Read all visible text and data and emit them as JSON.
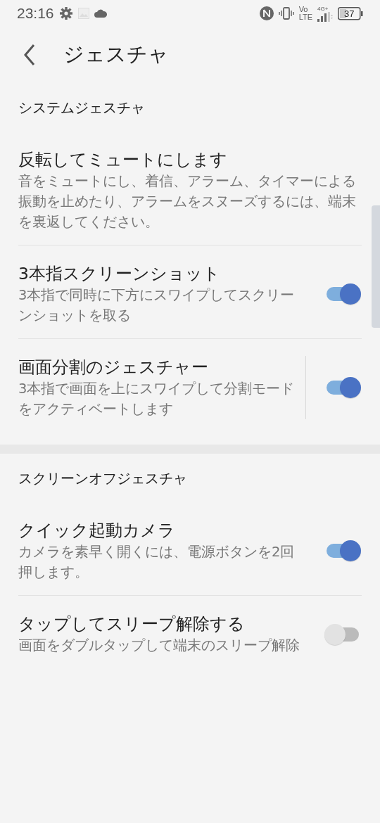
{
  "status_bar": {
    "time": "23:16",
    "volte_top": "Vo",
    "volte_bottom": "LTE",
    "network": "4G+",
    "battery": "37"
  },
  "header": {
    "title": "ジェスチャ"
  },
  "sections": [
    {
      "title": "システムジェスチャ",
      "items": [
        {
          "kind": "plain",
          "title": "反転してミュートにします",
          "summary": "音をミュートにし、着信、アラーム、タイマーによる振動を止めたり、アラームをスヌーズするには、端末を裏返してください。"
        },
        {
          "kind": "switch",
          "title": "3本指スクリーンショット",
          "summary": "3本指で同時に下方にスワイプしてスクリーンショットを取る",
          "on": true,
          "divider": false
        },
        {
          "kind": "switch",
          "title": "画面分割のジェスチャー",
          "summary": "3本指で画面を上にスワイプして分割モードをアクティベートします",
          "on": true,
          "divider": true
        }
      ]
    },
    {
      "title": "スクリーンオフジェスチャ",
      "items": [
        {
          "kind": "switch",
          "title": "クイック起動カメラ",
          "summary": "カメラを素早く開くには、電源ボタンを2回押します。",
          "on": true,
          "divider": false
        },
        {
          "kind": "switch",
          "title": "タップしてスリープ解除する",
          "summary": "画面をダブルタップして端末のスリープ解除",
          "on": false,
          "divider": false
        }
      ]
    }
  ]
}
